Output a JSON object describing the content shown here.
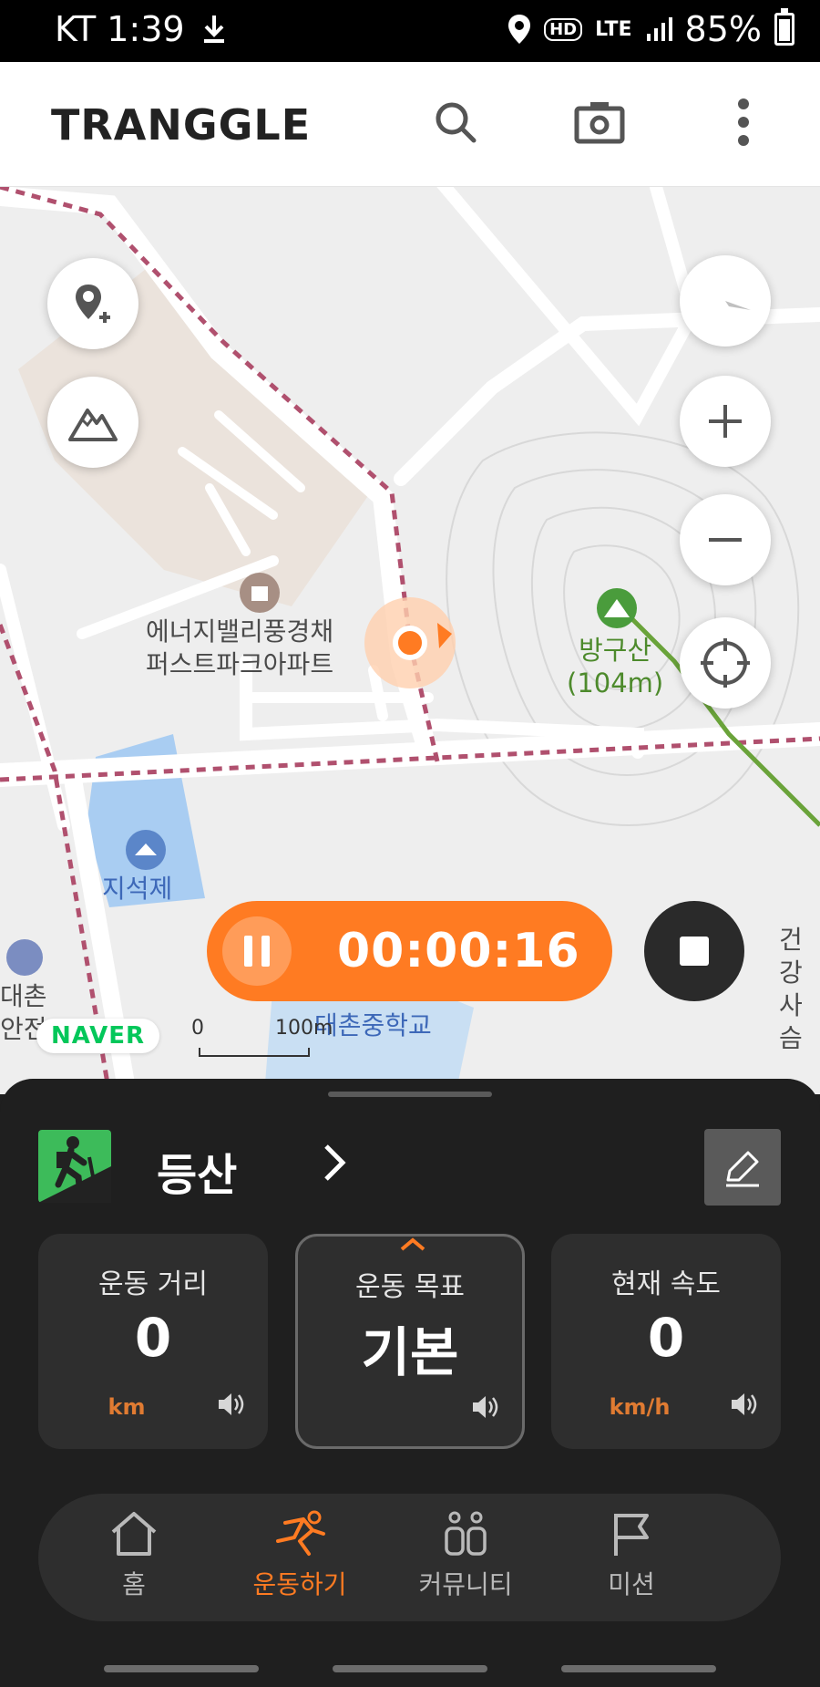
{
  "status_bar": {
    "carrier_time": "KT 1:39",
    "network": "LTE",
    "hd": "HD",
    "battery": "85%"
  },
  "header": {
    "logo": "TRANGGLE",
    "icons": [
      "search-icon",
      "camera-icon",
      "more-vertical-icon"
    ]
  },
  "map": {
    "labels": {
      "apartment": "에너지밸리풍경채\n퍼스트파크아파트",
      "mountain": "방구산\n(104m)",
      "reservoir": "지석제",
      "school": "대촌중학교",
      "left_edge": "대촌\n안전",
      "right_edge": "건강\n사슴"
    },
    "naver": "NAVER",
    "scale_zero": "0",
    "scale_unit": "100m",
    "colors": {
      "route": "#b0506e",
      "trail": "#6aa33a",
      "accent": "#ff7b22"
    }
  },
  "controls": {
    "add_place": "map-pin-plus-icon",
    "terrain": "mountain-icon",
    "compass": "compass-icon",
    "zoom_in": "plus-icon",
    "zoom_out": "minus-icon",
    "locate": "crosshair-icon"
  },
  "recording": {
    "elapsed": "00:00:16"
  },
  "activity": {
    "name": "등산"
  },
  "stats": [
    {
      "label": "운동 거리",
      "value": "0",
      "unit": "km"
    },
    {
      "label": "운동 목표",
      "value": "기본",
      "unit": ""
    },
    {
      "label": "현재 속도",
      "value": "0",
      "unit": "km/h"
    }
  ],
  "tabs": [
    {
      "label": "홈",
      "icon": "home-icon"
    },
    {
      "label": "운동하기",
      "icon": "run-icon"
    },
    {
      "label": "커뮤니티",
      "icon": "community-icon"
    },
    {
      "label": "미션",
      "icon": "flag-icon"
    }
  ]
}
